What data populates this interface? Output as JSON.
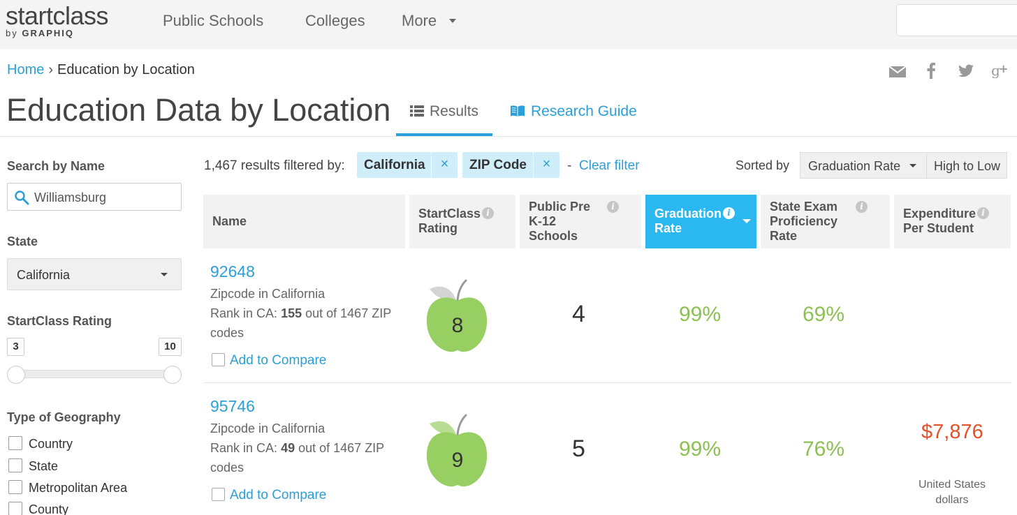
{
  "header": {
    "logo_main": "startclass",
    "logo_by": "by",
    "logo_brand": "GRAPHIQ",
    "nav": [
      "Public Schools",
      "Colleges",
      "More"
    ]
  },
  "breadcrumb": {
    "home": "Home",
    "separator": "›",
    "current": "Education by Location"
  },
  "share_icons": [
    "email-icon",
    "facebook-icon",
    "twitter-icon",
    "google-plus-icon"
  ],
  "page": {
    "title": "Education Data by Location",
    "tabs": [
      {
        "label": "Results",
        "icon": "list-icon",
        "active": true
      },
      {
        "label": "Research Guide",
        "icon": "book-icon",
        "active": false
      }
    ]
  },
  "sidebar": {
    "search_label": "Search by Name",
    "search_value": "Williamsburg",
    "state_label": "State",
    "state_value": "California",
    "rating_label": "StartClass Rating",
    "rating_min": "3",
    "rating_max": "10",
    "geo_label": "Type of Geography",
    "geo_options": [
      "Country",
      "State",
      "Metropolitan Area",
      "County"
    ]
  },
  "filters": {
    "count_text": "1,467 results filtered by:",
    "chips": [
      "California",
      "ZIP Code"
    ],
    "chip_close": "×",
    "dash": "-",
    "clear": "Clear filter",
    "sorted_by": "Sorted by",
    "sort_field": "Graduation Rate",
    "sort_order": "High to Low"
  },
  "table": {
    "columns": [
      {
        "label": "Name",
        "info": false
      },
      {
        "label": "StartClass Rating",
        "info": true
      },
      {
        "label": "Public Pre K-12 Schools",
        "info": true
      },
      {
        "label": "Graduation Rate",
        "info": true,
        "active": true
      },
      {
        "label": "State Exam Proficiency Rate",
        "info": true
      },
      {
        "label": "Expenditure Per Student",
        "info": true
      }
    ],
    "info_glyph": "i",
    "rows": [
      {
        "zip": "92648",
        "type": "Zipcode in California",
        "rank_prefix": "Rank in CA:",
        "rank": "155",
        "rank_suffix": "out of 1467 ZIP codes",
        "compare": "Add to Compare",
        "rating": "8",
        "schools": "4",
        "graduation": "99%",
        "proficiency": "69%",
        "expenditure": "",
        "expenditure_unit": ""
      },
      {
        "zip": "95746",
        "type": "Zipcode in California",
        "rank_prefix": "Rank in CA:",
        "rank": "49",
        "rank_suffix": "out of 1467 ZIP codes",
        "compare": "Add to Compare",
        "rating": "9",
        "schools": "5",
        "graduation": "99%",
        "proficiency": "76%",
        "expenditure": "$7,876",
        "expenditure_unit": "United States dollars"
      }
    ]
  },
  "colors": {
    "link": "#2a9fd8",
    "active_header": "#2bb7ef",
    "apple_green": "#97cf62",
    "good_value": "#8cc152",
    "money_value": "#e5502b",
    "chip_bg": "#cfeef9"
  }
}
